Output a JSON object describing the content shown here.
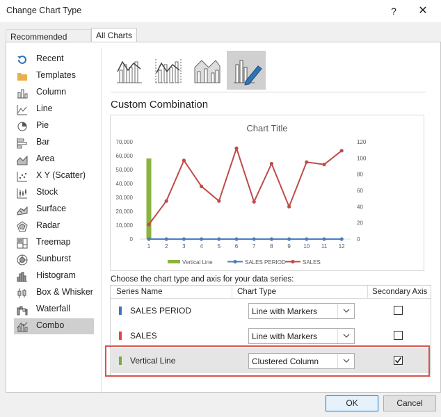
{
  "window": {
    "title": "Change Chart Type",
    "help": "?",
    "close": "✕"
  },
  "tabs": [
    {
      "label": "Recommended Charts",
      "active": false
    },
    {
      "label": "All Charts",
      "active": true
    }
  ],
  "chart_types": [
    {
      "label": "Recent",
      "icon": "recent-icon"
    },
    {
      "label": "Templates",
      "icon": "folder-icon"
    },
    {
      "label": "Column",
      "icon": "column-chart-icon"
    },
    {
      "label": "Line",
      "icon": "line-chart-icon"
    },
    {
      "label": "Pie",
      "icon": "pie-chart-icon"
    },
    {
      "label": "Bar",
      "icon": "bar-chart-icon"
    },
    {
      "label": "Area",
      "icon": "area-chart-icon"
    },
    {
      "label": "X Y (Scatter)",
      "icon": "scatter-chart-icon"
    },
    {
      "label": "Stock",
      "icon": "stock-chart-icon"
    },
    {
      "label": "Surface",
      "icon": "surface-chart-icon"
    },
    {
      "label": "Radar",
      "icon": "radar-chart-icon"
    },
    {
      "label": "Treemap",
      "icon": "treemap-icon"
    },
    {
      "label": "Sunburst",
      "icon": "sunburst-icon"
    },
    {
      "label": "Histogram",
      "icon": "histogram-icon"
    },
    {
      "label": "Box & Whisker",
      "icon": "box-whisker-icon"
    },
    {
      "label": "Waterfall",
      "icon": "waterfall-icon"
    },
    {
      "label": "Combo",
      "icon": "combo-chart-icon",
      "selected": true
    }
  ],
  "subtypes_selected_index": 3,
  "section_heading": "Custom Combination",
  "chart_data": {
    "type": "bar",
    "title": "Chart Title",
    "categories": [
      "1",
      "2",
      "3",
      "4",
      "5",
      "6",
      "7",
      "8",
      "9",
      "10",
      "11",
      "12"
    ],
    "y_left": {
      "min": 0,
      "max": 70000,
      "ticks": [
        "0",
        "10,000",
        "20,000",
        "30,000",
        "40,000",
        "50,000",
        "60,000",
        "70,000"
      ]
    },
    "y_right": {
      "min": 0,
      "max": 120,
      "ticks": [
        "0",
        "20",
        "40",
        "60",
        "80",
        "100",
        "120"
      ]
    },
    "series": [
      {
        "name": "Vertical Line",
        "kind": "column",
        "axis": "primary",
        "color": "#8bb33f",
        "values": [
          58000,
          0,
          0,
          0,
          0,
          0,
          0,
          0,
          0,
          0,
          0,
          0
        ]
      },
      {
        "name": "SALES PERIOD",
        "kind": "line-markers",
        "axis": "primary",
        "color": "#4a7ebb",
        "values": [
          0,
          0,
          0,
          0,
          0,
          0,
          0,
          0,
          0,
          0,
          0,
          0
        ]
      },
      {
        "name": "SALES",
        "kind": "line-markers",
        "axis": "secondary",
        "color": "#be4b48",
        "values": [
          18,
          47,
          97,
          65,
          47,
          112,
          46,
          93,
          40,
          95,
          92,
          109
        ]
      }
    ]
  },
  "series_config": {
    "instruction": "Choose the chart type and axis for your data series:",
    "headers": {
      "name": "Series Name",
      "type": "Chart Type",
      "axis": "Secondary Axis"
    },
    "rows": [
      {
        "name": "SALES PERIOD",
        "color": "#4472c4",
        "chart_type": "Line with Markers",
        "secondary": false
      },
      {
        "name": "SALES",
        "color": "#e0464e",
        "chart_type": "Line with Markers",
        "secondary": false
      },
      {
        "name": "Vertical Line",
        "color": "#70ad47",
        "chart_type": "Clustered Column",
        "secondary": true
      }
    ]
  },
  "buttons": {
    "ok": "OK",
    "cancel": "Cancel"
  }
}
